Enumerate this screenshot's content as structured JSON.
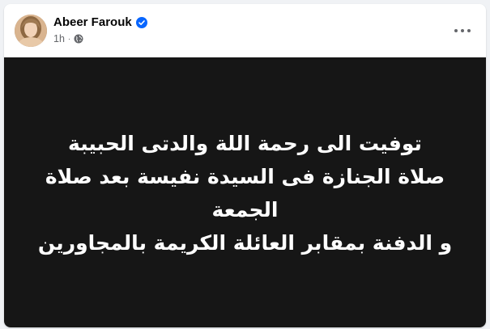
{
  "post": {
    "author": {
      "name": "Abeer Farouk",
      "verified": true,
      "avatar_icon": "profile-avatar",
      "verified_icon": "verified-badge-icon"
    },
    "meta": {
      "time": "1h",
      "separator": "·",
      "audience_icon": "globe-icon"
    },
    "more_icon": "more-options-icon",
    "content": {
      "background_color": "#161616",
      "text_color": "#ffffff",
      "lines": [
        "توفيت الى رحمة اللة والدتى الحبيبة",
        "صلاة الجنازة فى السيدة نفيسة بعد صلاة",
        "الجمعة",
        "و الدفنة بمقابر العائلة الكريمة بالمجاورين"
      ]
    }
  },
  "colors": {
    "verified_blue": "#0866ff",
    "secondary_text": "#65676b"
  }
}
